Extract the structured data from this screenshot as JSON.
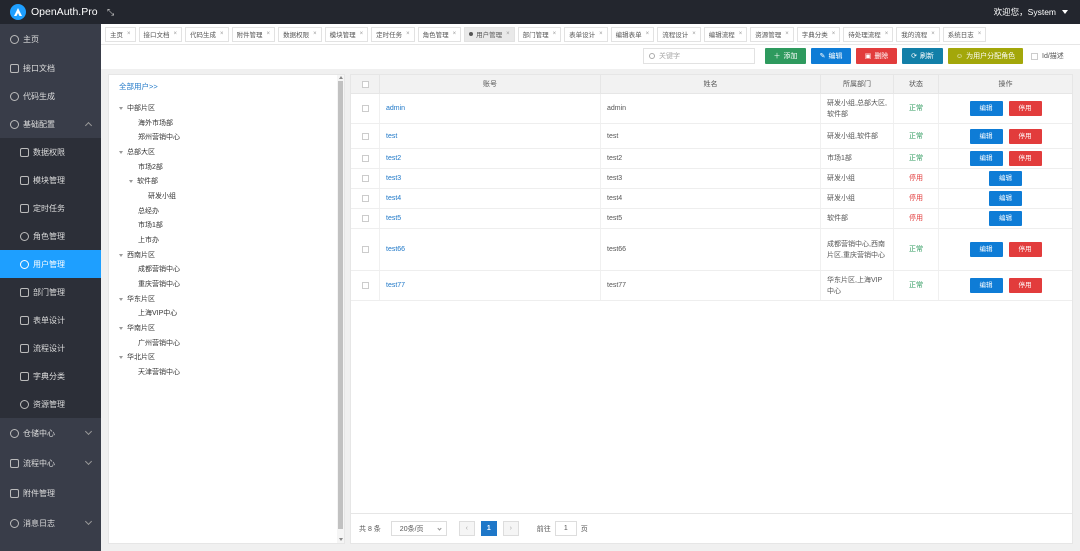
{
  "app": {
    "title": "OpenAuth.Pro",
    "welcome": "欢迎您，System"
  },
  "sidebar": {
    "items": [
      {
        "label": "主页",
        "icon": "home-icon"
      },
      {
        "label": "接口文档",
        "icon": "doc-icon"
      },
      {
        "label": "代码生成",
        "icon": "code-icon"
      },
      {
        "label": "基础配置",
        "icon": "gear-icon"
      },
      {
        "label": "数据权限",
        "icon": "data-icon"
      },
      {
        "label": "模块管理",
        "icon": "module-icon"
      },
      {
        "label": "定时任务",
        "icon": "clock-icon"
      },
      {
        "label": "角色管理",
        "icon": "role-icon"
      },
      {
        "label": "用户管理",
        "icon": "user-icon"
      },
      {
        "label": "部门管理",
        "icon": "dept-icon"
      },
      {
        "label": "表单设计",
        "icon": "form-icon"
      },
      {
        "label": "流程设计",
        "icon": "flow-icon"
      },
      {
        "label": "字典分类",
        "icon": "dict-icon"
      },
      {
        "label": "资源管理",
        "icon": "resource-icon"
      },
      {
        "label": "仓储中心",
        "icon": "warehouse-icon"
      },
      {
        "label": "流程中心",
        "icon": "flow-center-icon"
      },
      {
        "label": "附件管理",
        "icon": "attachment-icon"
      },
      {
        "label": "消息日志",
        "icon": "message-icon"
      }
    ]
  },
  "tabs": [
    "主页",
    "接口文档",
    "代码生成",
    "附件管理",
    "数据权限",
    "模块管理",
    "定时任务",
    "角色管理",
    "用户管理",
    "部门管理",
    "表单设计",
    "编辑表单",
    "流程设计",
    "编辑流程",
    "资源管理",
    "字典分类",
    "待处理流程",
    "我的流程",
    "系统日志"
  ],
  "toolbar": {
    "search_placeholder": "关键字",
    "add": "添加",
    "edit": "编辑",
    "delete": "删除",
    "refresh": "刷新",
    "assign_role": "为用户分配角色",
    "id_desc": "Id/描述"
  },
  "tree": {
    "header": "全部用户>>",
    "nodes": [
      "中部片区",
      "海外市场部",
      "郑州营销中心",
      "总部大区",
      "市场2部",
      "软件部",
      "研发小组",
      "总经办",
      "市场1部",
      "上市办",
      "西南片区",
      "成都营销中心",
      "重庆营销中心",
      "华东片区",
      "上海VIP中心",
      "华南片区",
      "广州营销中心",
      "华北片区",
      "天津营销中心"
    ]
  },
  "table": {
    "headers": {
      "account": "账号",
      "name": "姓名",
      "dept": "所属部门",
      "status": "状态",
      "ops": "操作"
    },
    "edit_label": "编辑",
    "disable_label": "停用",
    "rows": [
      {
        "account": "admin",
        "name": "admin",
        "dept": "研发小组,总部大区,软件部",
        "status": "正常"
      },
      {
        "account": "test",
        "name": "test",
        "dept": "研发小组,软件部",
        "status": "正常"
      },
      {
        "account": "test2",
        "name": "test2",
        "dept": "市场1部",
        "status": "正常"
      },
      {
        "account": "test3",
        "name": "test3",
        "dept": "研发小组",
        "status": "停用"
      },
      {
        "account": "test4",
        "name": "test4",
        "dept": "研发小组",
        "status": "停用"
      },
      {
        "account": "test5",
        "name": "test5",
        "dept": "软件部",
        "status": "停用"
      },
      {
        "account": "test66",
        "name": "test66",
        "dept": "成都营销中心,西南片区,重庆营销中心",
        "status": "正常"
      },
      {
        "account": "test77",
        "name": "test77",
        "dept": "华东片区,上海VIP中心",
        "status": "正常"
      }
    ]
  },
  "pager": {
    "total": "共 8 条",
    "page_size": "20条/页",
    "current": "1",
    "goto": "前往",
    "goto_value": "1",
    "page_unit": "页"
  }
}
